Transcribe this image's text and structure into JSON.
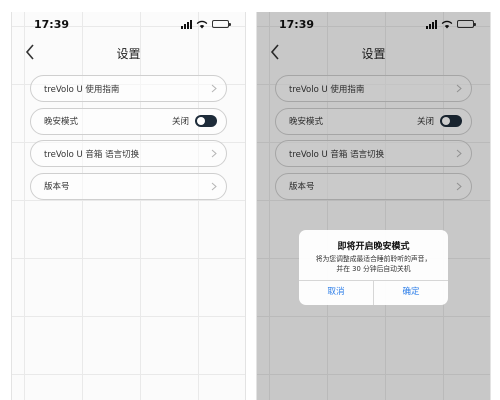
{
  "status_bar": {
    "time": "17:39"
  },
  "nav": {
    "title": "设置"
  },
  "settings": {
    "guide_label": "treVolo U 使用指南",
    "night_mode_label": "晚安模式",
    "night_mode_state": "关闭",
    "language_label": "treVolo U 音箱 语言切换",
    "version_label": "版本号"
  },
  "dialog": {
    "title": "即将开启晚安模式",
    "message_line1": "将为您调整成最适合睡前聆听的声音，",
    "message_line2": "并在 30 分钟后自动关机",
    "cancel_label": "取消",
    "confirm_label": "确定"
  },
  "colors": {
    "toggle_track": "#1e2c3a",
    "battery_fill": "#f7c400",
    "dialog_button_text": "#2b7de9"
  },
  "icons": [
    "back-arrow-icon",
    "chevron-right-icon",
    "signal-icon",
    "wifi-icon",
    "battery-icon"
  ]
}
